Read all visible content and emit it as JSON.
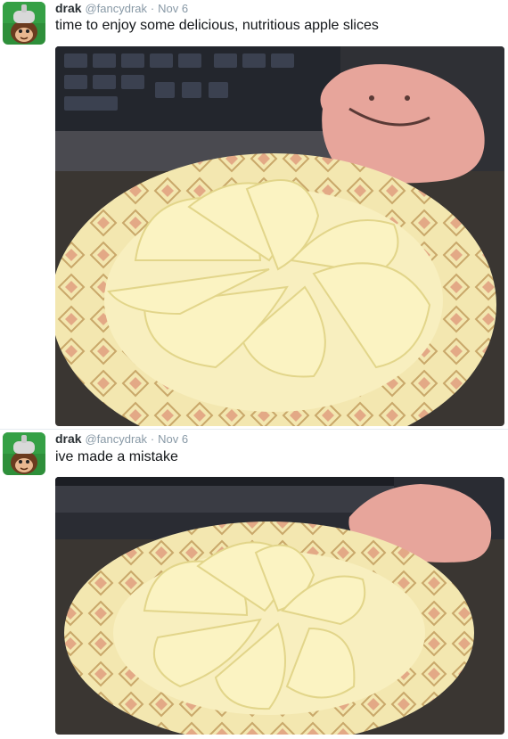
{
  "tweets": [
    {
      "author_name": "drak",
      "handle": "@fancydrak",
      "separator": "·",
      "date": "Nov 6",
      "text": "time to enjoy some delicious, nutritious apple slices",
      "avatar_icon": "monkey-helmet-avatar",
      "media": "photo of sliced onion wedges on a patterned paper plate beside a pink plush and keyboard"
    },
    {
      "author_name": "drak",
      "handle": "@fancydrak",
      "separator": "·",
      "date": "Nov 6",
      "text": "ive made a mistake",
      "avatar_icon": "monkey-helmet-avatar",
      "media": "second photo of the onion wedges on the paper plate"
    }
  ],
  "colors": {
    "name": "#292f33",
    "meta": "#8899a6",
    "text": "#14171a",
    "avatar_bg": "#2e8f3a",
    "plate": "#f2e6a6",
    "onion": "#fbf3c2",
    "plush": "#e7a59b"
  }
}
